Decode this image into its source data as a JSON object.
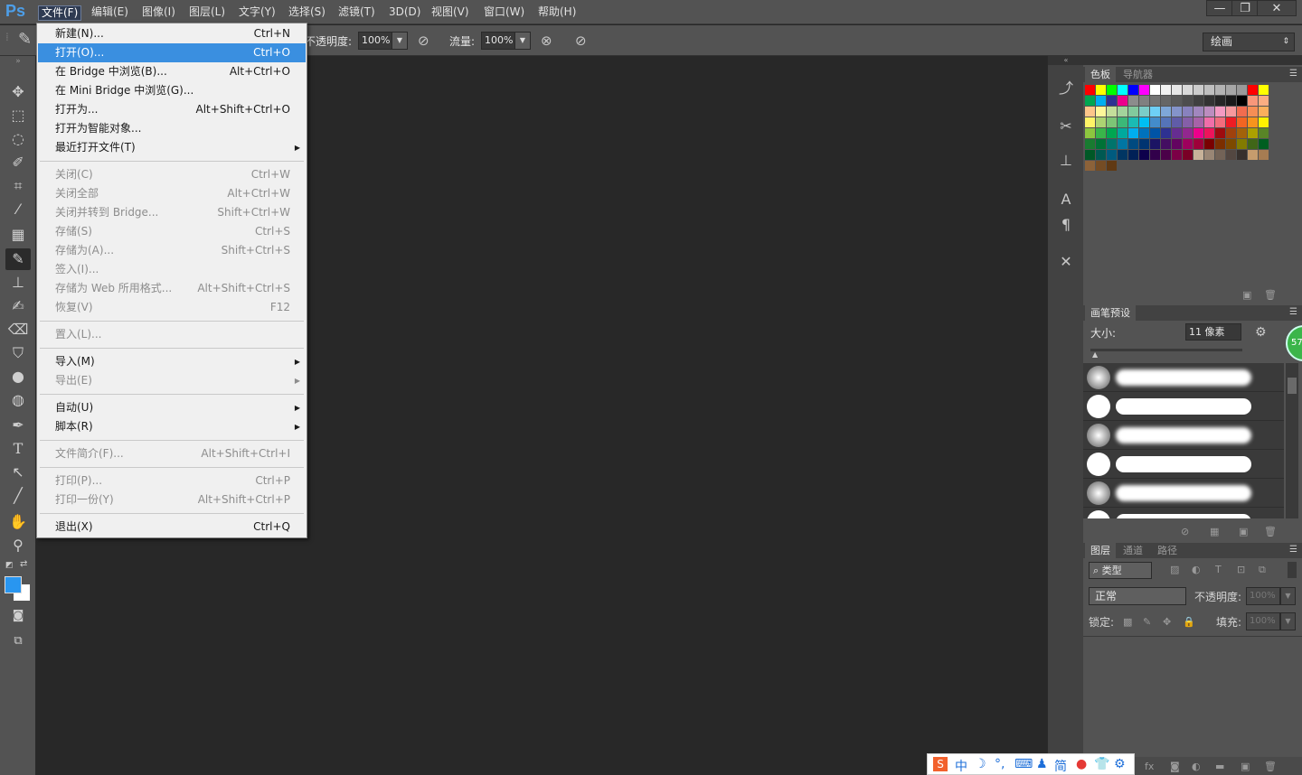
{
  "app": {
    "logo": "Ps"
  },
  "menubar": {
    "items": [
      "文件(F)",
      "编辑(E)",
      "图像(I)",
      "图层(L)",
      "文字(Y)",
      "选择(S)",
      "滤镜(T)",
      "3D(D)",
      "视图(V)",
      "窗口(W)",
      "帮助(H)"
    ],
    "active_index": 0
  },
  "window_controls": {
    "minimize": "—",
    "restore": "❐",
    "close": "✕"
  },
  "options_bar": {
    "opacity_label": "不透明度:",
    "opacity_value": "100%",
    "flow_label": "流量:",
    "flow_value": "100%",
    "workspace": "绘画"
  },
  "file_menu": {
    "items": [
      {
        "label": "新建(N)...",
        "shortcut": "Ctrl+N",
        "enabled": true,
        "highlighted": false,
        "submenu": false
      },
      {
        "label": "打开(O)...",
        "shortcut": "Ctrl+O",
        "enabled": true,
        "highlighted": true,
        "submenu": false
      },
      {
        "label": "在 Bridge 中浏览(B)...",
        "shortcut": "Alt+Ctrl+O",
        "enabled": true,
        "highlighted": false,
        "submenu": false
      },
      {
        "label": "在 Mini Bridge 中浏览(G)...",
        "shortcut": "",
        "enabled": true,
        "highlighted": false,
        "submenu": false
      },
      {
        "label": "打开为...",
        "shortcut": "Alt+Shift+Ctrl+O",
        "enabled": true,
        "highlighted": false,
        "submenu": false
      },
      {
        "label": "打开为智能对象...",
        "shortcut": "",
        "enabled": true,
        "highlighted": false,
        "submenu": false
      },
      {
        "label": "最近打开文件(T)",
        "shortcut": "",
        "enabled": true,
        "highlighted": false,
        "submenu": true
      },
      {
        "separator": true
      },
      {
        "label": "关闭(C)",
        "shortcut": "Ctrl+W",
        "enabled": false,
        "highlighted": false,
        "submenu": false
      },
      {
        "label": "关闭全部",
        "shortcut": "Alt+Ctrl+W",
        "enabled": false,
        "highlighted": false,
        "submenu": false
      },
      {
        "label": "关闭并转到 Bridge...",
        "shortcut": "Shift+Ctrl+W",
        "enabled": false,
        "highlighted": false,
        "submenu": false
      },
      {
        "label": "存储(S)",
        "shortcut": "Ctrl+S",
        "enabled": false,
        "highlighted": false,
        "submenu": false
      },
      {
        "label": "存储为(A)...",
        "shortcut": "Shift+Ctrl+S",
        "enabled": false,
        "highlighted": false,
        "submenu": false
      },
      {
        "label": "签入(I)...",
        "shortcut": "",
        "enabled": false,
        "highlighted": false,
        "submenu": false
      },
      {
        "label": "存储为 Web 所用格式...",
        "shortcut": "Alt+Shift+Ctrl+S",
        "enabled": false,
        "highlighted": false,
        "submenu": false
      },
      {
        "label": "恢复(V)",
        "shortcut": "F12",
        "enabled": false,
        "highlighted": false,
        "submenu": false
      },
      {
        "separator": true
      },
      {
        "label": "置入(L)...",
        "shortcut": "",
        "enabled": false,
        "highlighted": false,
        "submenu": false
      },
      {
        "separator": true
      },
      {
        "label": "导入(M)",
        "shortcut": "",
        "enabled": true,
        "highlighted": false,
        "submenu": true
      },
      {
        "label": "导出(E)",
        "shortcut": "",
        "enabled": false,
        "highlighted": false,
        "submenu": true
      },
      {
        "separator": true
      },
      {
        "label": "自动(U)",
        "shortcut": "",
        "enabled": true,
        "highlighted": false,
        "submenu": true
      },
      {
        "label": "脚本(R)",
        "shortcut": "",
        "enabled": true,
        "highlighted": false,
        "submenu": true
      },
      {
        "separator": true
      },
      {
        "label": "文件简介(F)...",
        "shortcut": "Alt+Shift+Ctrl+I",
        "enabled": false,
        "highlighted": false,
        "submenu": false
      },
      {
        "separator": true
      },
      {
        "label": "打印(P)...",
        "shortcut": "Ctrl+P",
        "enabled": false,
        "highlighted": false,
        "submenu": false
      },
      {
        "label": "打印一份(Y)",
        "shortcut": "Alt+Shift+Ctrl+P",
        "enabled": false,
        "highlighted": false,
        "submenu": false
      },
      {
        "separator": true
      },
      {
        "label": "退出(X)",
        "shortcut": "Ctrl+Q",
        "enabled": true,
        "highlighted": false,
        "submenu": false
      }
    ]
  },
  "swatches_panel": {
    "tabs": [
      "色板",
      "导航器"
    ],
    "colors": [
      [
        "#ff0000",
        "#ffff00",
        "#00ff00",
        "#00ffff",
        "#0000ff",
        "#ff00ff",
        "#ffffff",
        "#f2f2f2",
        "#e6e6e6",
        "#d9d9d9",
        "#cccccc",
        "#bfbfbf",
        "#b3b3b3",
        "#a6a6a6",
        "#999999",
        "#ff0000",
        "#ffff00"
      ],
      [
        "#00a651",
        "#00aeef",
        "#2e3192",
        "#ec008c",
        "#8c8c8c",
        "#808080",
        "#737373",
        "#666666",
        "#595959",
        "#4d4d4d",
        "#404040",
        "#333333",
        "#262626",
        "#1a1a1a",
        "#000000",
        "#f7977a",
        "#fbad82"
      ],
      [
        "#fdc68a",
        "#fff79a",
        "#c4df9b",
        "#a3d39c",
        "#82ca9d",
        "#7bcdc8",
        "#6ecff6",
        "#7ea7d8",
        "#8493ca",
        "#8882be",
        "#a187be",
        "#bc8dbf",
        "#f49ac2",
        "#f6989d",
        "#f26c4f",
        "#f68e55",
        "#fbaf5c"
      ],
      [
        "#fff467",
        "#acd372",
        "#7cc576",
        "#3bb878",
        "#1abbb4",
        "#00bff3",
        "#438ccb",
        "#5574b9",
        "#605ca8",
        "#855fa8",
        "#a763a8",
        "#f06ea9",
        "#f26d7d",
        "#ed1c24",
        "#f26522",
        "#f7941d",
        "#fff200"
      ],
      [
        "#8dc63f",
        "#39b54a",
        "#00a651",
        "#00a99d",
        "#00aeef",
        "#0072bc",
        "#0054a6",
        "#2e3192",
        "#662d91",
        "#92278f",
        "#ec008c",
        "#ed145b",
        "#9e0b0f",
        "#a0410d",
        "#a3620a",
        "#aba000",
        "#598527"
      ],
      [
        "#197b30",
        "#007236",
        "#00746b",
        "#0076a3",
        "#004a80",
        "#003471",
        "#1b1464",
        "#440e62",
        "#630460",
        "#9e005d",
        "#9e0039",
        "#790000",
        "#7b2e00",
        "#7d4900",
        "#827b00",
        "#406618",
        "#005e20"
      ],
      [
        "#005826",
        "#005952",
        "#005b7f",
        "#003663",
        "#002157",
        "#0d004c",
        "#32004b",
        "#4b0049",
        "#7b0046",
        "#7a0026",
        "#c7b299",
        "#998675",
        "#736357",
        "#534741",
        "#37302d",
        "#c69c6d",
        "#a67c52"
      ]
    ],
    "last_row": [
      "#8c6239",
      "#754c24",
      "#603913"
    ]
  },
  "brush_presets_panel": {
    "title": "画笔预设",
    "size_label": "大小:",
    "size_value": "11 像素",
    "badge": "57"
  },
  "layers_panel": {
    "tabs": [
      "图层",
      "通道",
      "路径"
    ],
    "filter_label": "类型",
    "blend_mode": "正常",
    "opacity_label": "不透明度:",
    "opacity_value": "100%",
    "lock_label": "锁定:",
    "fill_label": "填充:",
    "fill_value": "100%"
  },
  "ime_bar": {
    "items": [
      "S",
      "中",
      "☽",
      "°,",
      "⌨",
      "♟",
      "简",
      "●",
      "👕",
      "⚙"
    ]
  }
}
